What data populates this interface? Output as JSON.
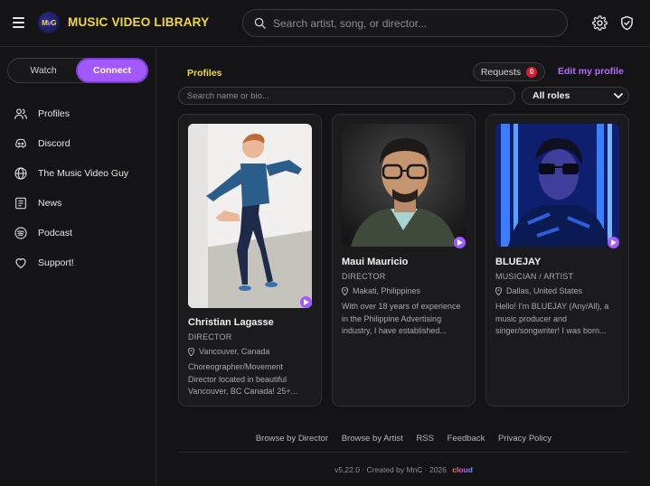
{
  "header": {
    "app_title": "MUSIC VIDEO LIBRARY",
    "logo_text": "MvG",
    "search_placeholder": "Search artist, song, or director..."
  },
  "sidebar": {
    "toggle": {
      "watch": "Watch",
      "connect": "Connect",
      "active": "Connect"
    },
    "items": [
      {
        "label": "Profiles",
        "icon": "users-icon"
      },
      {
        "label": "Discord",
        "icon": "discord-icon"
      },
      {
        "label": "The Music Video Guy",
        "icon": "globe-icon"
      },
      {
        "label": "News",
        "icon": "newspaper-icon"
      },
      {
        "label": "Podcast",
        "icon": "spotify-icon"
      },
      {
        "label": "Support!",
        "icon": "heart-icon"
      }
    ]
  },
  "main": {
    "tab": "Profiles",
    "requests_label": "Requests",
    "requests_count": "0",
    "edit_label": "Edit my profile",
    "filter_placeholder": "Search name or bio...",
    "role_filter": "All roles",
    "profiles": [
      {
        "name": "Christian Lagasse",
        "role": "DIRECTOR",
        "location": "Vancouver, Canada",
        "bio": "Choreographer/Movement Director located in beautiful Vancouver, BC Canada! 25+..."
      },
      {
        "name": "Maui Mauricio",
        "role": "DIRECTOR",
        "location": "Makati, Philippines",
        "bio": "With over 18 years of experience in the Philippine Advertising industry, I have established..."
      },
      {
        "name": "BLUEJAY",
        "role": "MUSICIAN / ARTIST",
        "location": "Dallas, United States",
        "bio": "Hello! I'm BLUEJAY (Any/All), a music producer and singer/songwriter! I was born..."
      }
    ]
  },
  "footer": {
    "links": [
      "Browse by Director",
      "Browse by Artist",
      "RSS",
      "Feedback",
      "Privacy Policy"
    ],
    "meta": "v5.22.0 · Created by MnC · 2026",
    "brand": "cloud"
  },
  "colors": {
    "accent": "#a259ff",
    "title_yellow": "#f5d839",
    "badge_red": "#d8192f"
  }
}
